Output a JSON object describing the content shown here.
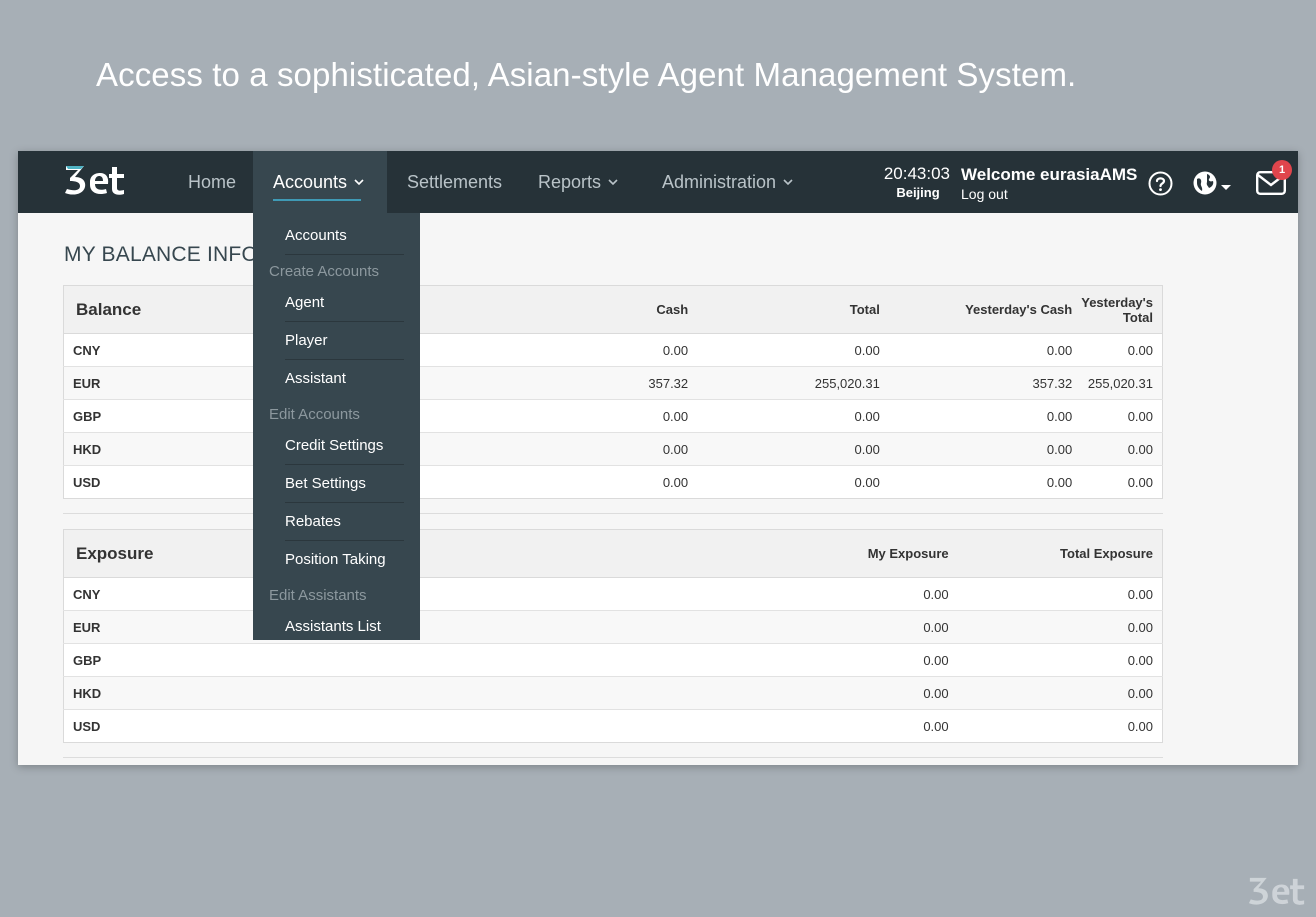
{
  "headline": "Access to a sophisticated, Asian-style Agent Management System.",
  "brand": {
    "logo_icon": "3et-logo-icon"
  },
  "nav": {
    "home": "Home",
    "accounts": "Accounts",
    "settlements": "Settlements",
    "reports": "Reports",
    "administration": "Administration"
  },
  "header": {
    "time": "20:43:03",
    "city": "Beijing",
    "welcome": "Welcome eurasiaAMS",
    "logout": "Log out",
    "message_count": "1"
  },
  "dropdown": {
    "accounts": "Accounts",
    "create_header": "Create Accounts",
    "agent": "Agent",
    "player": "Player",
    "assistant": "Assistant",
    "edit_header": "Edit Accounts",
    "credit": "Credit Settings",
    "bet": "Bet Settings",
    "rebates": "Rebates",
    "position": "Position Taking",
    "assist_header": "Edit Assistants",
    "assist_list": "Assistants List"
  },
  "page": {
    "title": "MY BALANCE INFOR"
  },
  "balance": {
    "headers": [
      "Balance",
      "",
      "Cash",
      "Total",
      "Yesterday's Cash",
      "Yesterday's Total"
    ],
    "rows": [
      [
        "CNY",
        "",
        "0.00",
        "0.00",
        "0.00",
        "0.00"
      ],
      [
        "EUR",
        "",
        "357.32",
        "255,020.31",
        "357.32",
        "255,020.31"
      ],
      [
        "GBP",
        "",
        "0.00",
        "0.00",
        "0.00",
        "0.00"
      ],
      [
        "HKD",
        "",
        "0.00",
        "0.00",
        "0.00",
        "0.00"
      ],
      [
        "USD",
        "",
        "0.00",
        "0.00",
        "0.00",
        "0.00"
      ]
    ]
  },
  "exposure": {
    "headers": [
      "Exposure",
      "My Exposure",
      "Total Exposure"
    ],
    "rows": [
      [
        "CNY",
        "0.00",
        "0.00"
      ],
      [
        "EUR",
        "0.00",
        "0.00"
      ],
      [
        "GBP",
        "0.00",
        "0.00"
      ],
      [
        "HKD",
        "0.00",
        "0.00"
      ],
      [
        "USD",
        "0.00",
        "0.00"
      ]
    ]
  }
}
